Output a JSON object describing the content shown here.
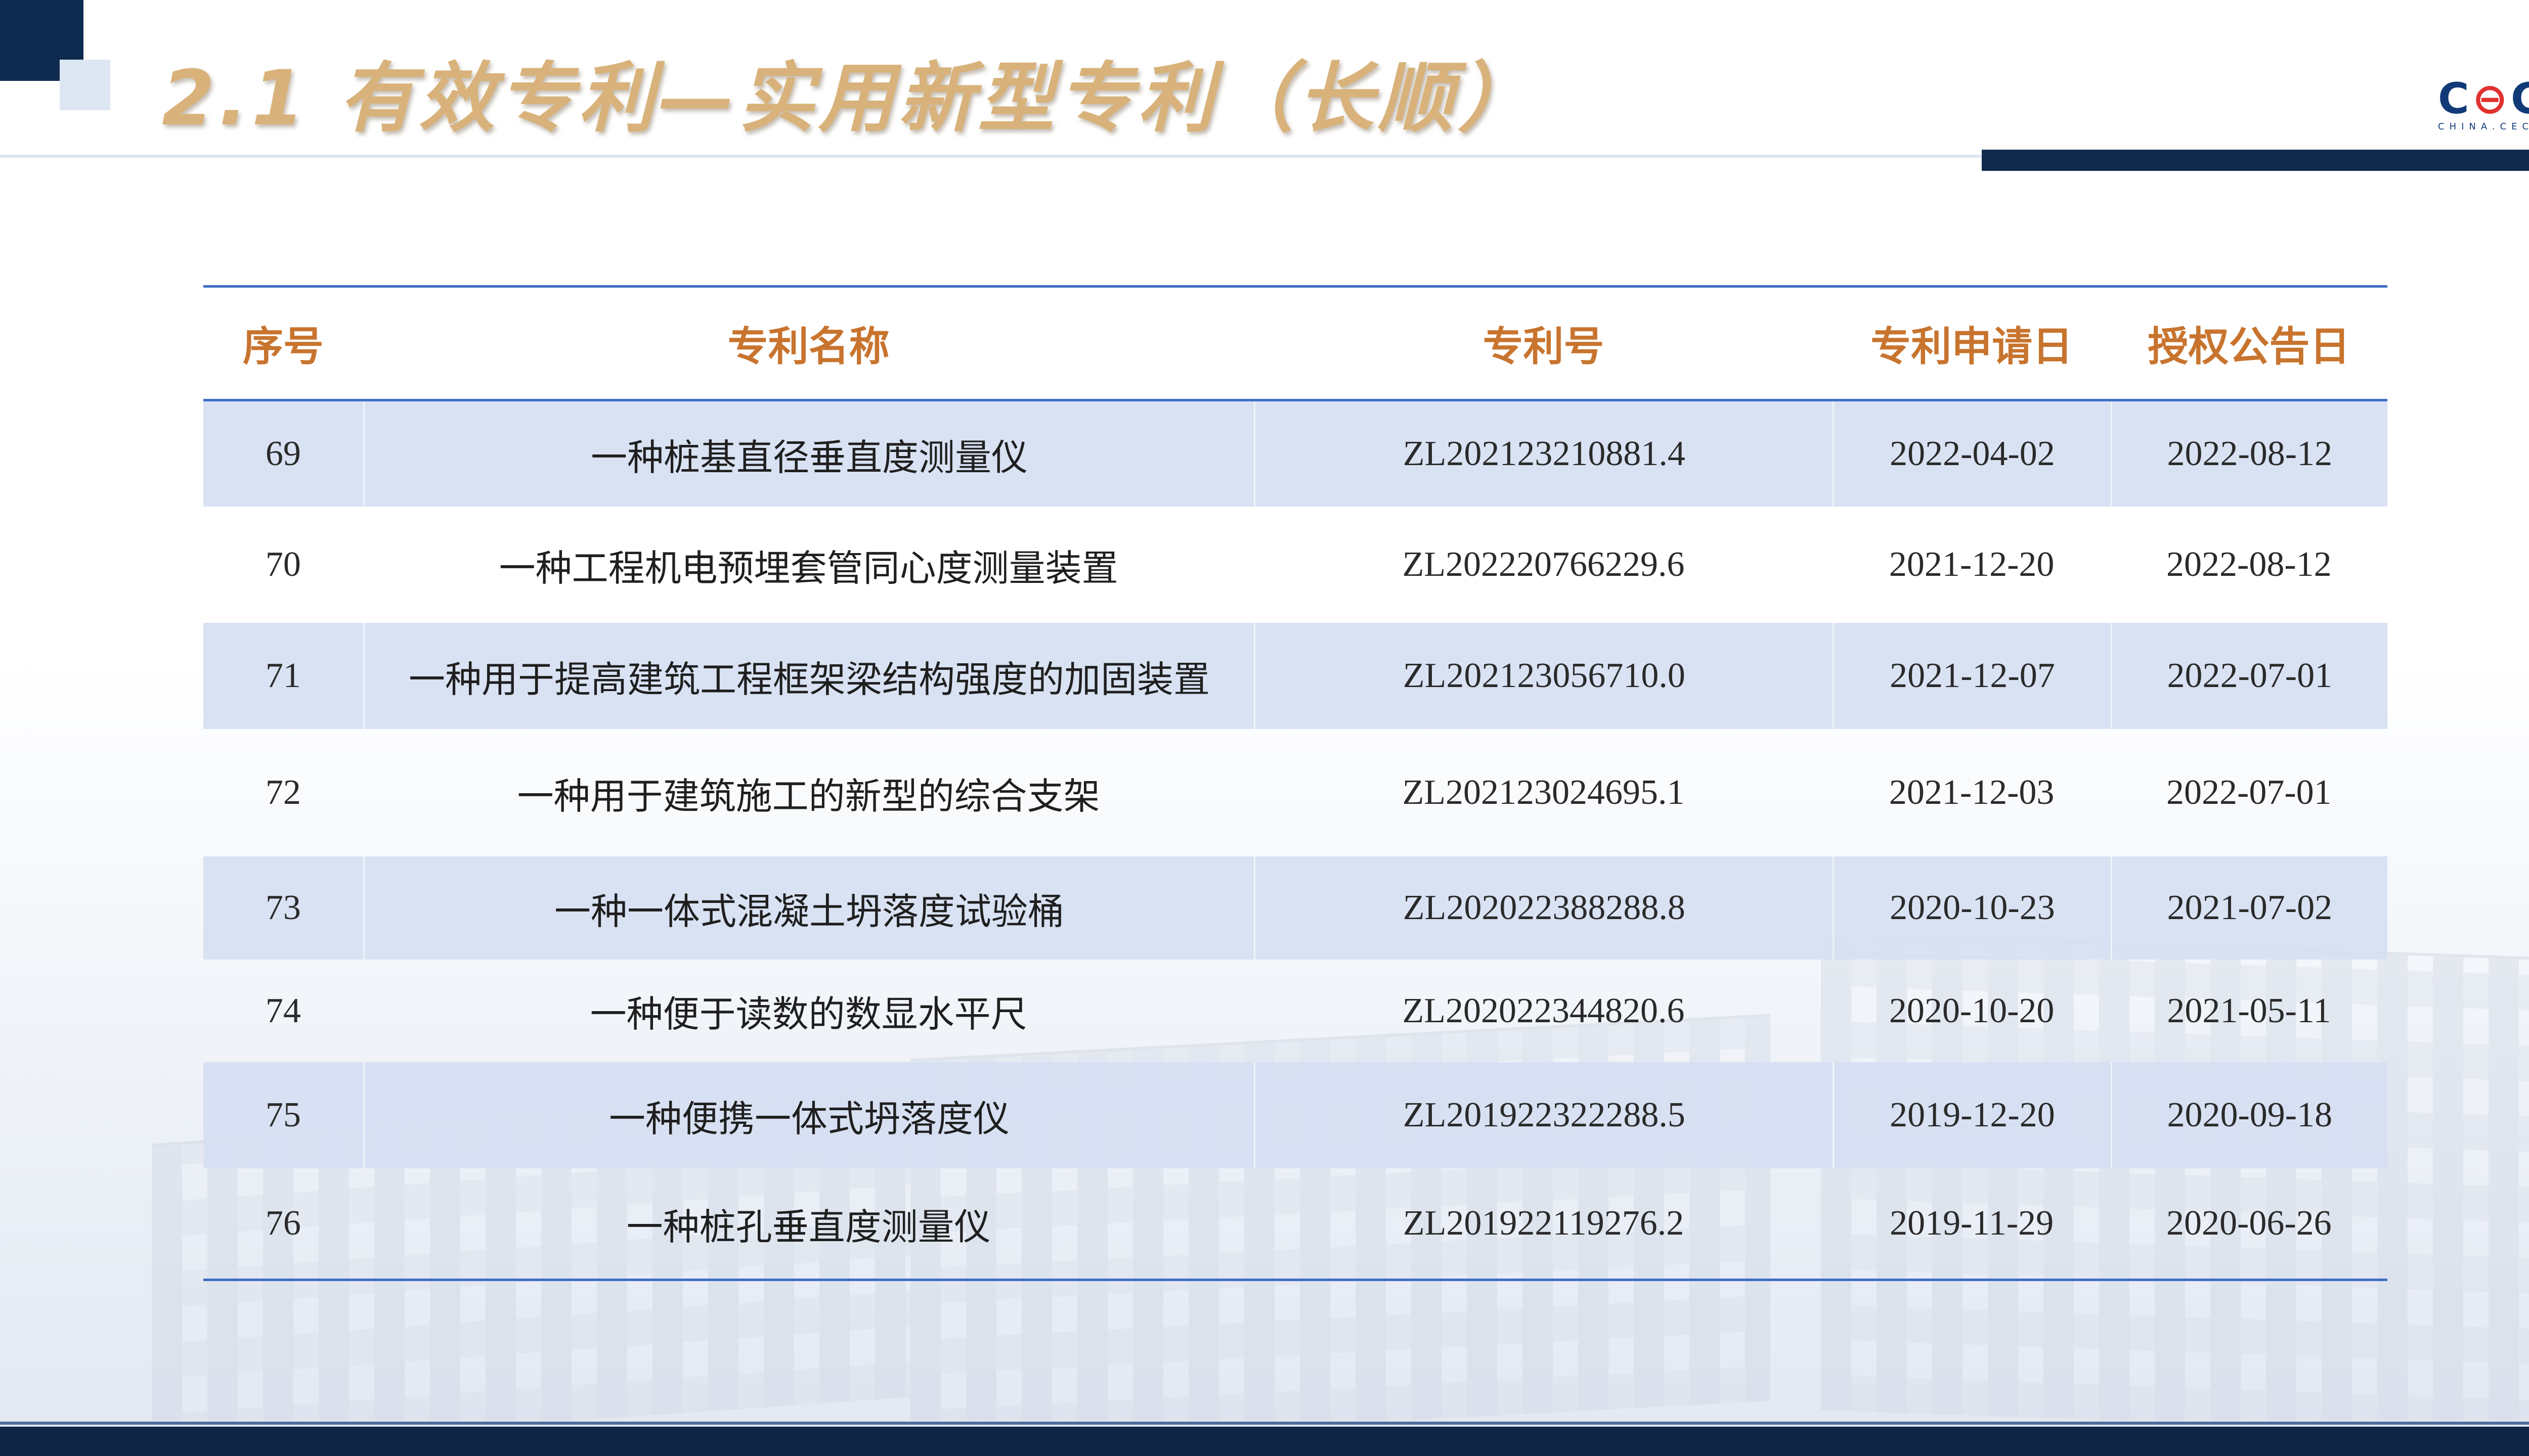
{
  "slide": {
    "title": "2.1 有效专利—实用新型专利（长顺）",
    "logo": {
      "mark_left": "C",
      "mark_middle": "⊖",
      "mark_right": "C",
      "subtitle": "CHINA.CEC"
    },
    "colors": {
      "title": "#d8b27a",
      "header_text": "#c8742e",
      "rule": "#3f6fc4",
      "band": "#d6e0f2",
      "navy": "#0f2646"
    }
  },
  "table": {
    "headers": [
      "序号",
      "专利名称",
      "专利号",
      "专利申请日",
      "授权公告日"
    ],
    "rows": [
      {
        "no": "69",
        "name": "一种桩基直径垂直度测量仪",
        "patent": "ZL202123210881.4",
        "applied": "2022-04-02",
        "granted": "2022-08-12"
      },
      {
        "no": "70",
        "name": "一种工程机电预埋套管同心度测量装置",
        "patent": "ZL202220766229.6",
        "applied": "2021-12-20",
        "granted": "2022-08-12"
      },
      {
        "no": "71",
        "name": "一种用于提高建筑工程框架梁结构强度的加固装置",
        "patent": "ZL202123056710.0",
        "applied": "2021-12-07",
        "granted": "2022-07-01"
      },
      {
        "no": "72",
        "name": "一种用于建筑施工的新型的综合支架",
        "patent": "ZL202123024695.1",
        "applied": "2021-12-03",
        "granted": "2022-07-01"
      },
      {
        "no": "73",
        "name": "一种一体式混凝土坍落度试验桶",
        "patent": "ZL202022388288.8",
        "applied": "2020-10-23",
        "granted": "2021-07-02"
      },
      {
        "no": "74",
        "name": "一种便于读数的数显水平尺",
        "patent": "ZL202022344820.6",
        "applied": "2020-10-20",
        "granted": "2021-05-11"
      },
      {
        "no": "75",
        "name": "一种便携一体式坍落度仪",
        "patent": "ZL201922322288.5",
        "applied": "2019-12-20",
        "granted": "2020-09-18"
      },
      {
        "no": "76",
        "name": "一种桩孔垂直度测量仪",
        "patent": "ZL201922119276.2",
        "applied": "2019-11-29",
        "granted": "2020-06-26"
      }
    ]
  }
}
